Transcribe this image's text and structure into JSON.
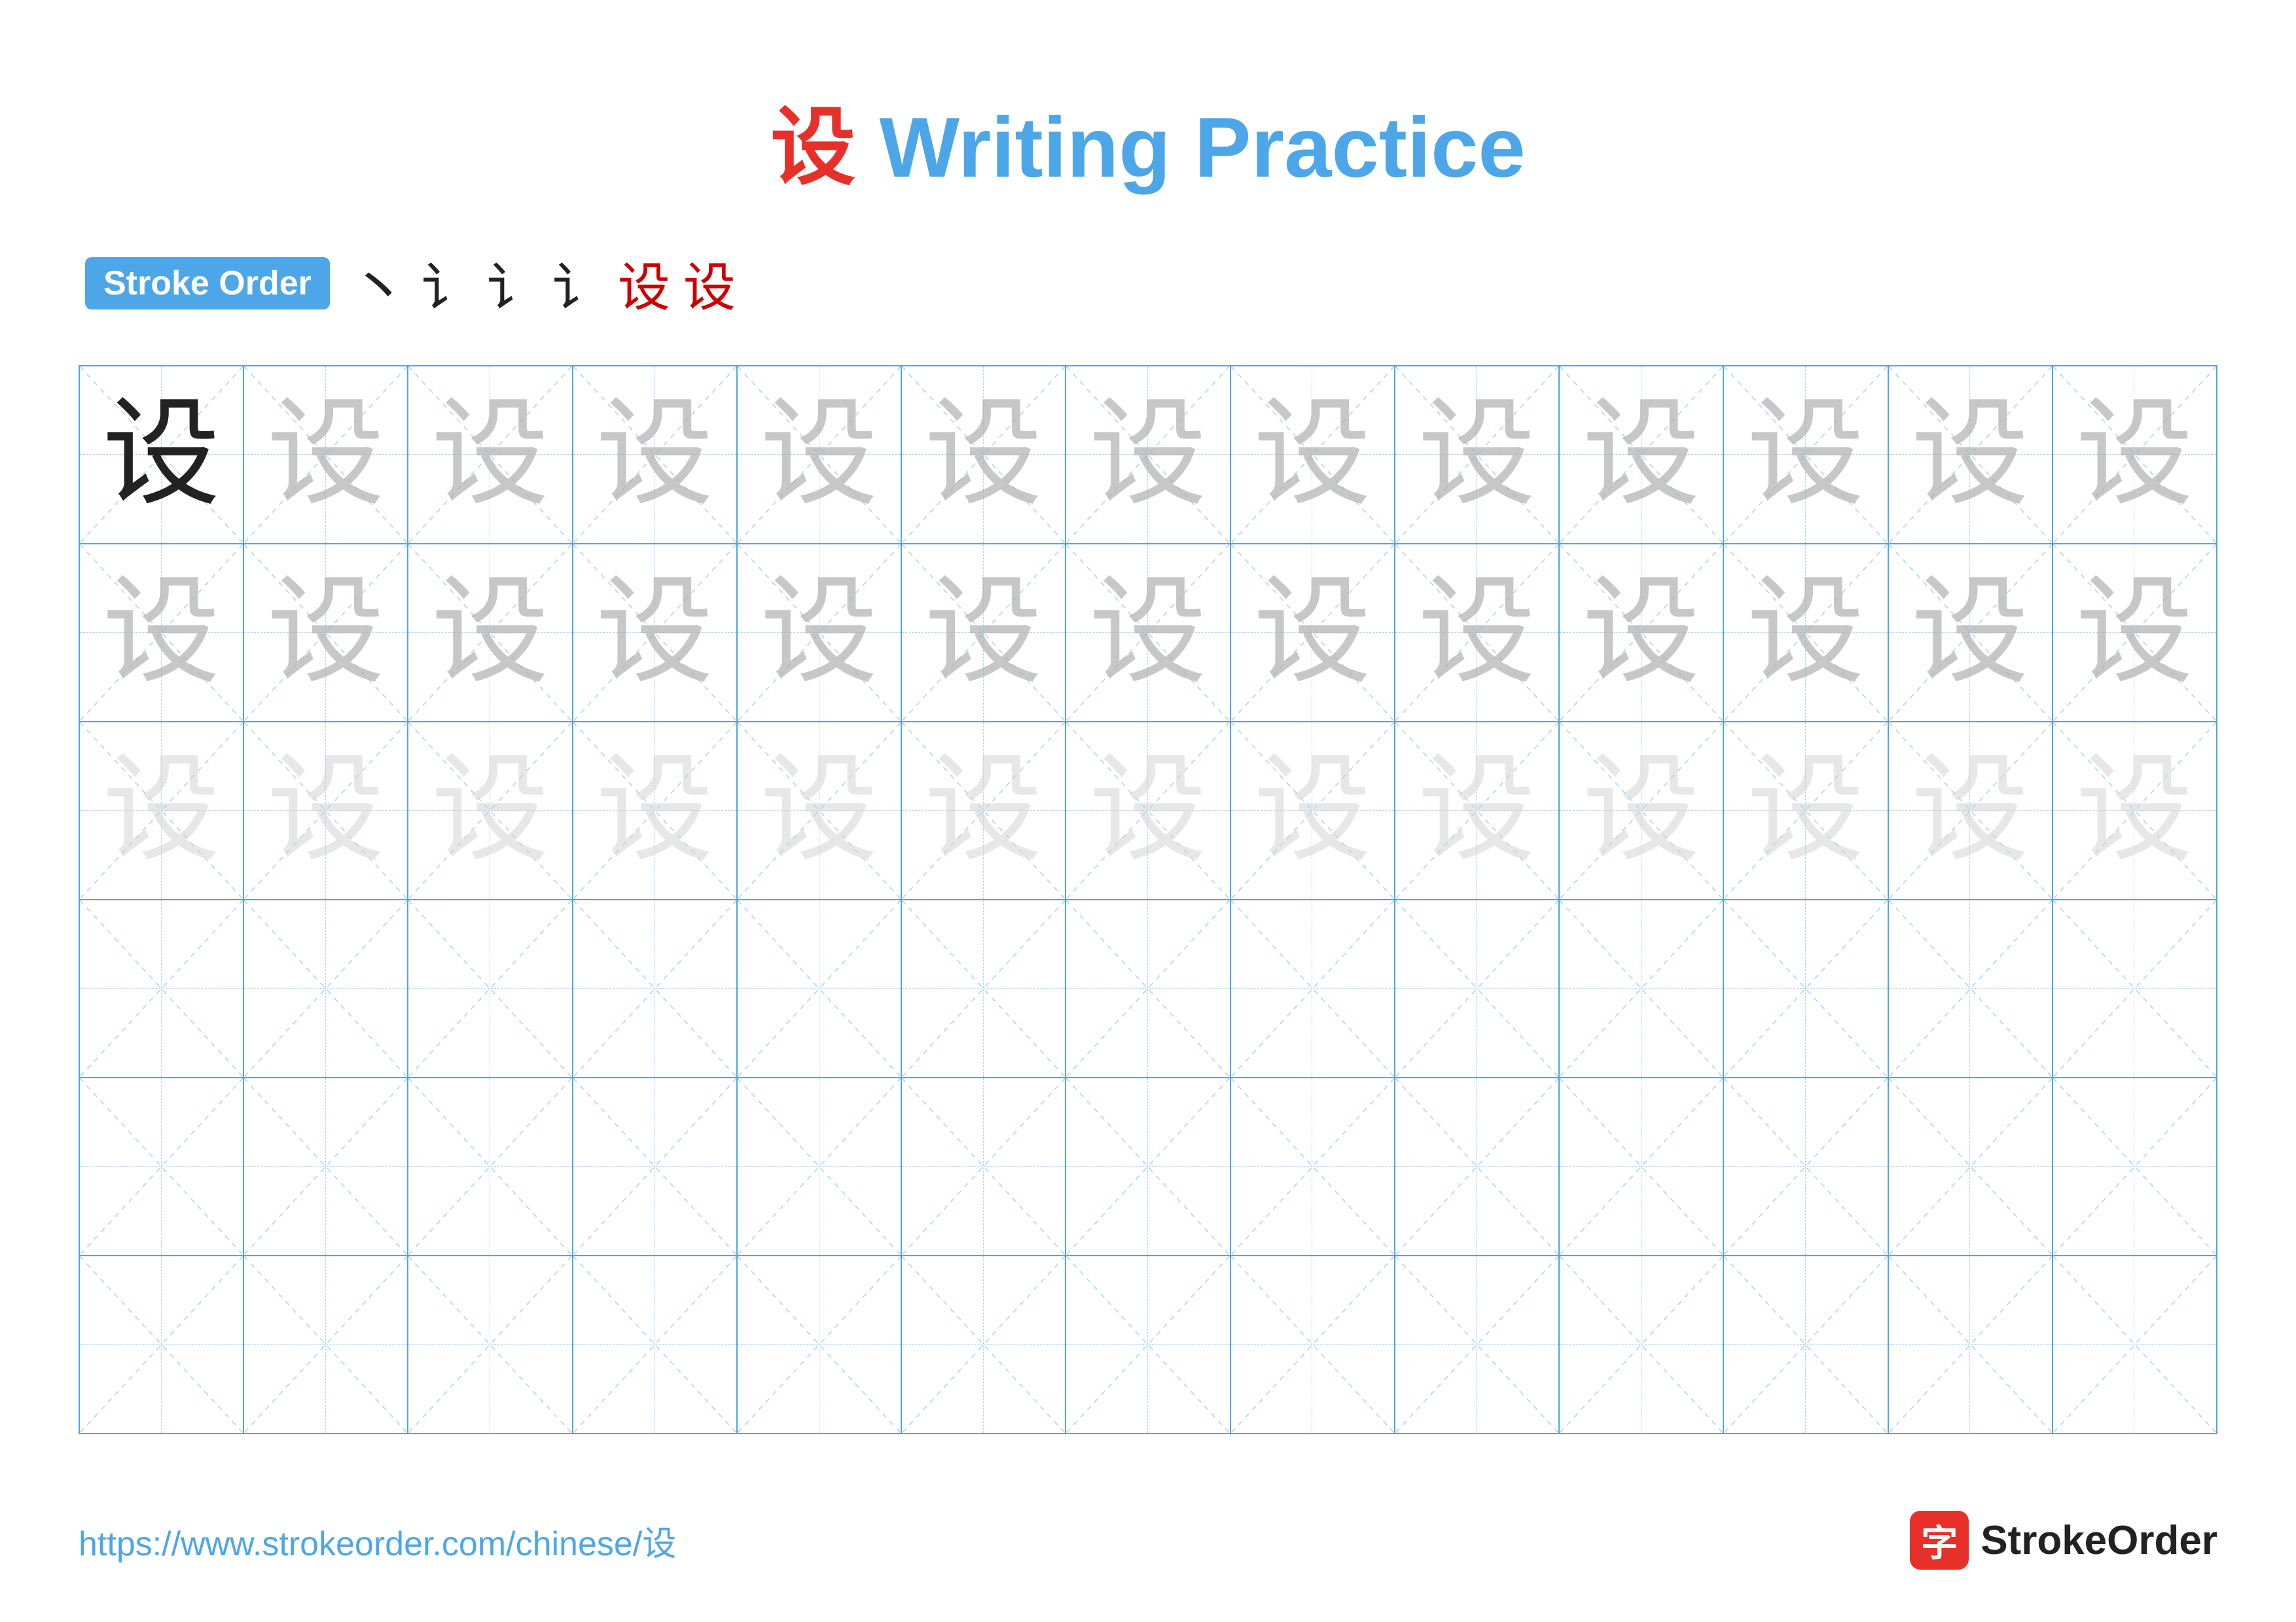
{
  "page": {
    "title": "设 Writing Practice",
    "title_char": "设",
    "title_suffix": " Writing Practice",
    "stroke_order_label": "Stroke Order",
    "stroke_sequence": [
      "丶",
      "i",
      "i'",
      "i\"",
      "设",
      "设"
    ],
    "character": "设",
    "rows": [
      {
        "type": "dark_then_medium",
        "chars": [
          "dark",
          "medium",
          "medium",
          "medium",
          "medium",
          "medium",
          "medium",
          "medium",
          "medium",
          "medium",
          "medium",
          "medium",
          "medium"
        ]
      },
      {
        "type": "medium",
        "chars": [
          "medium",
          "medium",
          "medium",
          "medium",
          "medium",
          "medium",
          "medium",
          "medium",
          "medium",
          "medium",
          "medium",
          "medium",
          "medium"
        ]
      },
      {
        "type": "light",
        "chars": [
          "light",
          "light",
          "light",
          "light",
          "light",
          "light",
          "light",
          "light",
          "light",
          "light",
          "light",
          "light",
          "light"
        ]
      },
      {
        "type": "empty"
      },
      {
        "type": "empty"
      },
      {
        "type": "empty"
      }
    ],
    "footer": {
      "url": "https://www.strokeorder.com/chinese/设",
      "logo_char": "字",
      "logo_name": "StrokeOrder"
    }
  }
}
